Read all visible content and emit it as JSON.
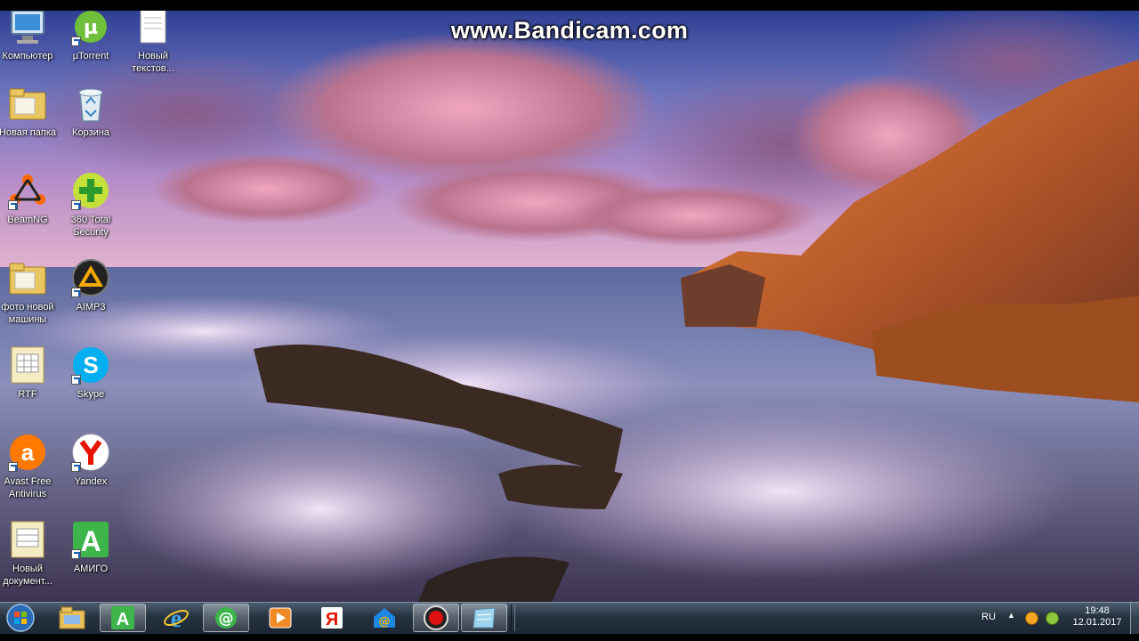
{
  "screen": {
    "watermark": "www.Bandicam.com"
  },
  "desktop_icons": [
    {
      "id": "computer",
      "label": "Компьютер",
      "icon": "computer-icon",
      "shortcut": false
    },
    {
      "id": "utorrent",
      "label": "µTorrent",
      "icon": "utorrent-icon",
      "shortcut": true
    },
    {
      "id": "new-text",
      "label": "Новый\nтекстов...",
      "icon": "text-document-icon",
      "shortcut": false
    },
    {
      "id": "new-folder",
      "label": "Новая папка",
      "icon": "folder-icon",
      "shortcut": false
    },
    {
      "id": "recycle-bin",
      "label": "Корзина",
      "icon": "recycle-bin-icon",
      "shortcut": false
    },
    {
      "id": "beamng",
      "label": "BeamNG",
      "icon": "beamng-icon",
      "shortcut": true
    },
    {
      "id": "360-security",
      "label": "360 Total\nSecurity",
      "icon": "360-security-icon",
      "shortcut": true
    },
    {
      "id": "photo-folder",
      "label": "фото новой\nмашины",
      "icon": "folder-icon",
      "shortcut": false
    },
    {
      "id": "aimp3",
      "label": "AIMP3",
      "icon": "aimp-icon",
      "shortcut": true
    },
    {
      "id": "rtf",
      "label": "RTF",
      "icon": "rtf-document-icon",
      "shortcut": false
    },
    {
      "id": "skype",
      "label": "Skype",
      "icon": "skype-icon",
      "shortcut": true
    },
    {
      "id": "avast",
      "label": "Avast Free\nAntivirus",
      "icon": "avast-icon",
      "shortcut": true
    },
    {
      "id": "yandex",
      "label": "Yandex",
      "icon": "yandex-icon",
      "shortcut": true
    },
    {
      "id": "new-doc",
      "label": "Новый\nдокумент...",
      "icon": "document-icon",
      "shortcut": false
    },
    {
      "id": "amigo",
      "label": "АМИГО",
      "icon": "amigo-icon",
      "shortcut": true
    }
  ],
  "taskbar": {
    "buttons": [
      {
        "id": "start",
        "icon": "windows-start-icon"
      },
      {
        "id": "explorer",
        "icon": "file-explorer-icon"
      },
      {
        "id": "amigo",
        "icon": "amigo-icon"
      },
      {
        "id": "ie",
        "icon": "internet-explorer-icon"
      },
      {
        "id": "mail-agent",
        "icon": "mail-agent-icon"
      },
      {
        "id": "media-player",
        "icon": "media-player-icon"
      },
      {
        "id": "yandex",
        "icon": "yandex-icon"
      },
      {
        "id": "mail",
        "icon": "mail-icon"
      },
      {
        "id": "bandicam",
        "icon": "record-icon"
      },
      {
        "id": "notepad",
        "icon": "notepad-icon"
      }
    ],
    "tray": {
      "language": "RU",
      "time": "19:48",
      "date": "12.01.2017",
      "icons": [
        "show-hidden-icons-icon",
        "orange-tray-icon",
        "360-tray-icon"
      ]
    }
  },
  "colors": {
    "taskbar": "#25323f",
    "sky_top": "#3a4fa0",
    "cliff": "#c76a2a"
  }
}
